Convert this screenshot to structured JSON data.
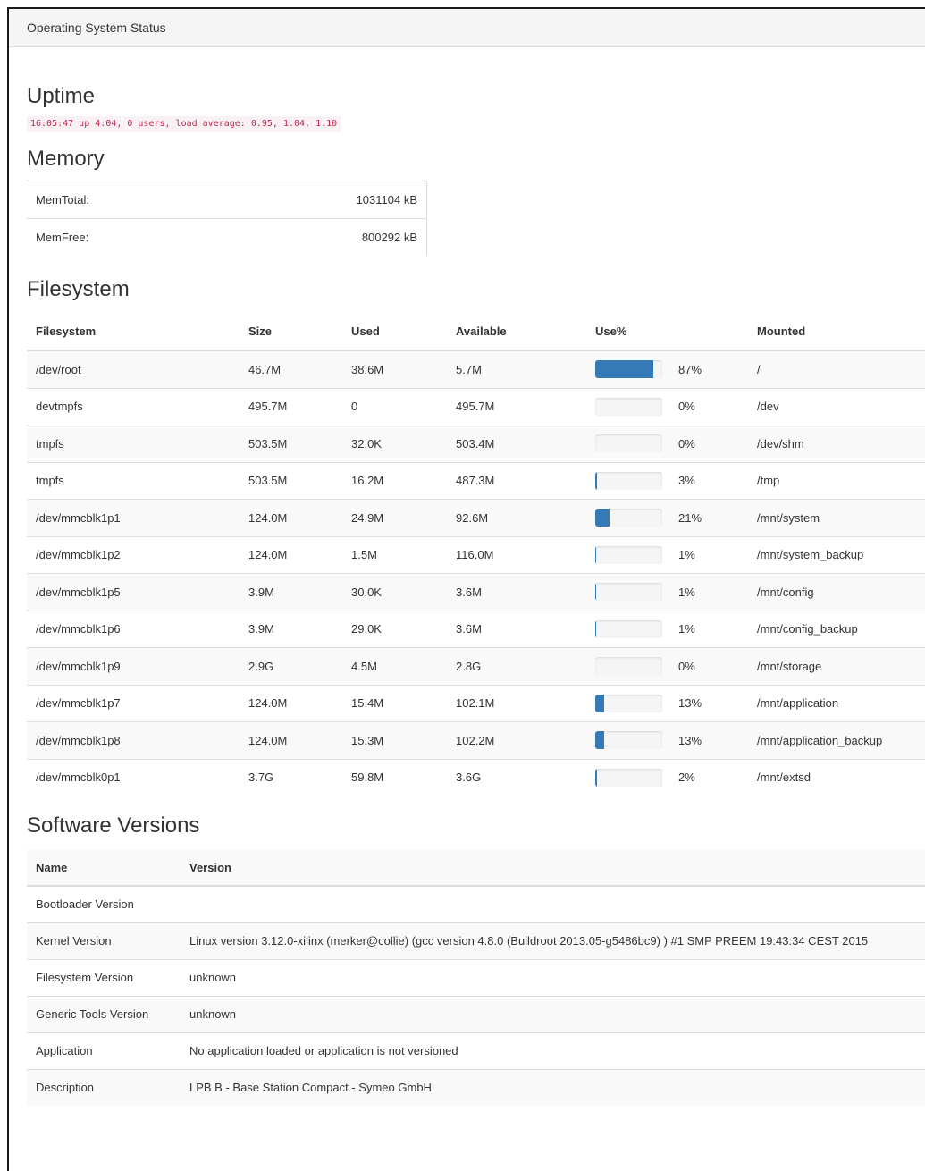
{
  "panel_title": "Operating System Status",
  "uptime": {
    "heading": "Uptime",
    "text": "16:05:47 up 4:04, 0 users, load average: 0.95, 1.04, 1.10"
  },
  "memory": {
    "heading": "Memory",
    "rows": [
      {
        "label": "MemTotal:",
        "value": "1031104 kB"
      },
      {
        "label": "MemFree:",
        "value": "800292 kB"
      }
    ]
  },
  "filesystem": {
    "heading": "Filesystem",
    "columns": [
      "Filesystem",
      "Size",
      "Used",
      "Available",
      "Use%",
      "Mounted"
    ],
    "rows": [
      {
        "fs": "/dev/root",
        "size": "46.7M",
        "used": "38.6M",
        "avail": "5.7M",
        "pct": "87%",
        "pct_value": 87,
        "mount": "/"
      },
      {
        "fs": "devtmpfs",
        "size": "495.7M",
        "used": "0",
        "avail": "495.7M",
        "pct": "0%",
        "pct_value": 0,
        "mount": "/dev"
      },
      {
        "fs": "tmpfs",
        "size": "503.5M",
        "used": "32.0K",
        "avail": "503.4M",
        "pct": "0%",
        "pct_value": 0,
        "mount": "/dev/shm"
      },
      {
        "fs": "tmpfs",
        "size": "503.5M",
        "used": "16.2M",
        "avail": "487.3M",
        "pct": "3%",
        "pct_value": 3,
        "mount": "/tmp"
      },
      {
        "fs": "/dev/mmcblk1p1",
        "size": "124.0M",
        "used": "24.9M",
        "avail": "92.6M",
        "pct": "21%",
        "pct_value": 21,
        "mount": "/mnt/system"
      },
      {
        "fs": "/dev/mmcblk1p2",
        "size": "124.0M",
        "used": "1.5M",
        "avail": "116.0M",
        "pct": "1%",
        "pct_value": 1,
        "mount": "/mnt/system_backup"
      },
      {
        "fs": "/dev/mmcblk1p5",
        "size": "3.9M",
        "used": "30.0K",
        "avail": "3.6M",
        "pct": "1%",
        "pct_value": 1,
        "mount": "/mnt/config"
      },
      {
        "fs": "/dev/mmcblk1p6",
        "size": "3.9M",
        "used": "29.0K",
        "avail": "3.6M",
        "pct": "1%",
        "pct_value": 1,
        "mount": "/mnt/config_backup"
      },
      {
        "fs": "/dev/mmcblk1p9",
        "size": "2.9G",
        "used": "4.5M",
        "avail": "2.8G",
        "pct": "0%",
        "pct_value": 0,
        "mount": "/mnt/storage"
      },
      {
        "fs": "/dev/mmcblk1p7",
        "size": "124.0M",
        "used": "15.4M",
        "avail": "102.1M",
        "pct": "13%",
        "pct_value": 13,
        "mount": "/mnt/application"
      },
      {
        "fs": "/dev/mmcblk1p8",
        "size": "124.0M",
        "used": "15.3M",
        "avail": "102.2M",
        "pct": "13%",
        "pct_value": 13,
        "mount": "/mnt/application_backup"
      },
      {
        "fs": "/dev/mmcblk0p1",
        "size": "3.7G",
        "used": "59.8M",
        "avail": "3.6G",
        "pct": "2%",
        "pct_value": 2,
        "mount": "/mnt/extsd"
      }
    ]
  },
  "software": {
    "heading": "Software Versions",
    "columns": [
      "Name",
      "Version"
    ],
    "rows": [
      {
        "name": "Bootloader Version",
        "version": ""
      },
      {
        "name": "Kernel Version",
        "version": "Linux version 3.12.0-xilinx (merker@collie) (gcc version 4.8.0 (Buildroot 2013.05-g5486bc9) ) #1 SMP PREEM 19:43:34 CEST 2015"
      },
      {
        "name": "Filesystem Version",
        "version": "unknown"
      },
      {
        "name": "Generic Tools Version",
        "version": "unknown"
      },
      {
        "name": "Application",
        "version": "No application loaded or application is not versioned"
      },
      {
        "name": "Description",
        "version": "LPB B - Base Station Compact - Symeo GmbH"
      }
    ]
  },
  "colors": {
    "bar_fill": "#337ab7",
    "code_text": "#c7254e",
    "code_bg": "#f9f2f4"
  }
}
